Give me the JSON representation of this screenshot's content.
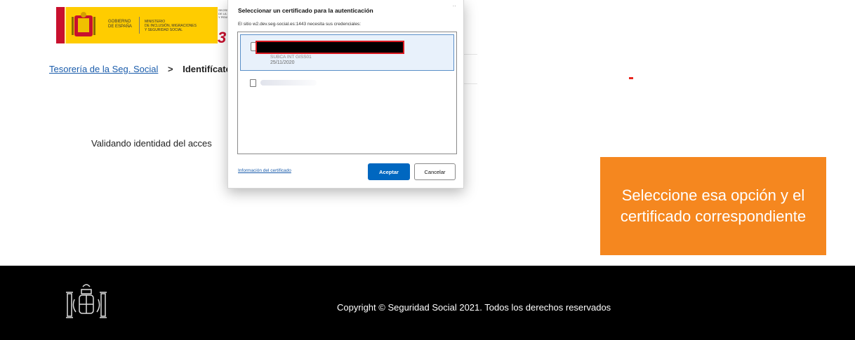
{
  "header": {
    "gov_line1": "GOBIERNO",
    "gov_line2": "DE ESPAÑA",
    "ministry_line1": "MINISTERIO",
    "ministry_line2": "DE INCLUSIÓN, MIGRACIONES",
    "ministry_line3": "Y SEGURIDAD SOCIAL",
    "secondary_line1": "SECRETARÍA",
    "secondary_line2": "DE LA S",
    "secondary_line3": "Y PENSION"
  },
  "breadcrumb": {
    "parent": "Tesorería de la Seg. Social",
    "separator": ">",
    "current": "Identifícate"
  },
  "main": {
    "status_text": "Validando identidad del acces"
  },
  "dialog": {
    "title": "Seleccionar un certificado para la autenticación",
    "subtitle": "El sitio w2.dev.seg-social.es:1443 necesita sus credenciales:",
    "certificates": [
      {
        "issuer": "SUBCA INT GISS01",
        "date": "25/11/2020",
        "selected": true
      }
    ],
    "info_link": "Información del certificado",
    "accept_label": "Aceptar",
    "cancel_label": "Cancelar",
    "accent": "#0067c0"
  },
  "callout": {
    "text": "Seleccione esa opción y el certificado correspondiente",
    "color": "#f5871f"
  },
  "footer": {
    "copyright": "Copyright © Seguridad Social 2021. Todos los derechos reservados"
  }
}
